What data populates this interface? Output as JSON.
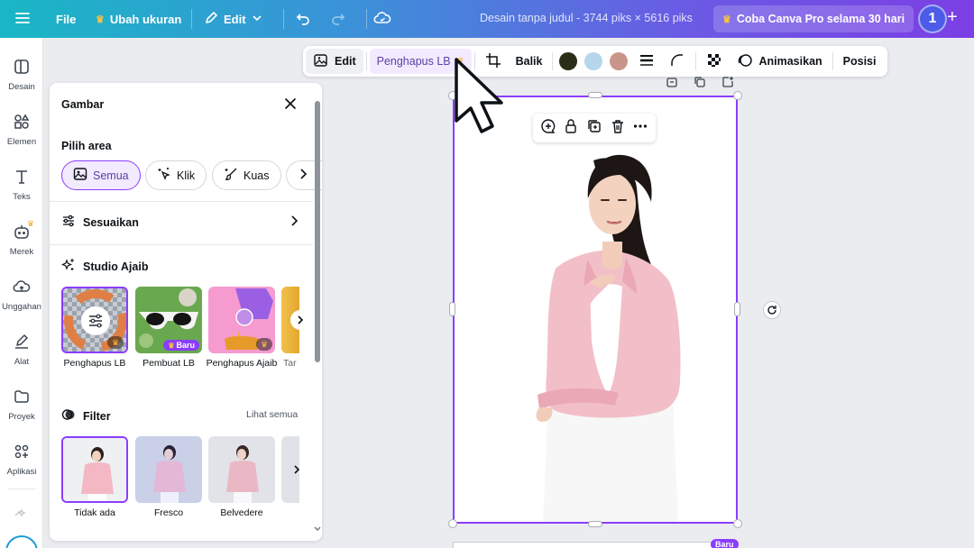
{
  "topbar": {
    "file": "File",
    "resize": "Ubah ukuran",
    "edit": "Edit",
    "doc_title": "Desain tanpa judul - 3744 piks × 5616 piks",
    "pro": "Coba Canva Pro selama 30 hari",
    "avatar": "1",
    "plus": "+"
  },
  "rail": [
    {
      "label": "Desain",
      "icon": "layout-icon"
    },
    {
      "label": "Elemen",
      "icon": "shapes-icon"
    },
    {
      "label": "Teks",
      "icon": "text-icon"
    },
    {
      "label": "Merek",
      "icon": "brand-icon"
    },
    {
      "label": "Unggahan",
      "icon": "cloud-upload-icon"
    },
    {
      "label": "Alat",
      "icon": "pen-icon"
    },
    {
      "label": "Proyek",
      "icon": "folder-icon"
    },
    {
      "label": "Aplikasi",
      "icon": "apps-icon"
    }
  ],
  "panel": {
    "title": "Gambar",
    "pick_area": "Pilih area",
    "chips": [
      {
        "label": "Semua",
        "active": true
      },
      {
        "label": "Klik",
        "active": false
      },
      {
        "label": "Kuas",
        "active": false
      }
    ],
    "adjust": "Sesuaikan",
    "magic_studio": "Studio Ajaib",
    "magic_tools": [
      {
        "label": "Penghapus LB"
      },
      {
        "label": "Pembuat LB",
        "badge": "Baru"
      },
      {
        "label": "Penghapus Ajaib"
      },
      {
        "label": "Tar"
      }
    ],
    "filter": "Filter",
    "see_all": "Lihat semua",
    "filters": [
      {
        "label": "Tidak ada"
      },
      {
        "label": "Fresco"
      },
      {
        "label": "Belvedere"
      }
    ]
  },
  "context_toolbar": {
    "edit": "Edit",
    "bg_remover": "Penghapus LB",
    "flip": "Balik",
    "animate": "Animasikan",
    "position": "Posisi",
    "swatches": [
      "#2b2e16",
      "#b6d6ee",
      "#c9958a"
    ]
  },
  "canvas": {
    "next_badge": "Baru"
  },
  "colors": {
    "accent": "#8b3dff",
    "blouse": "#f2bfc8",
    "skirt": "#f7f7f7",
    "hair": "#1d1614"
  }
}
